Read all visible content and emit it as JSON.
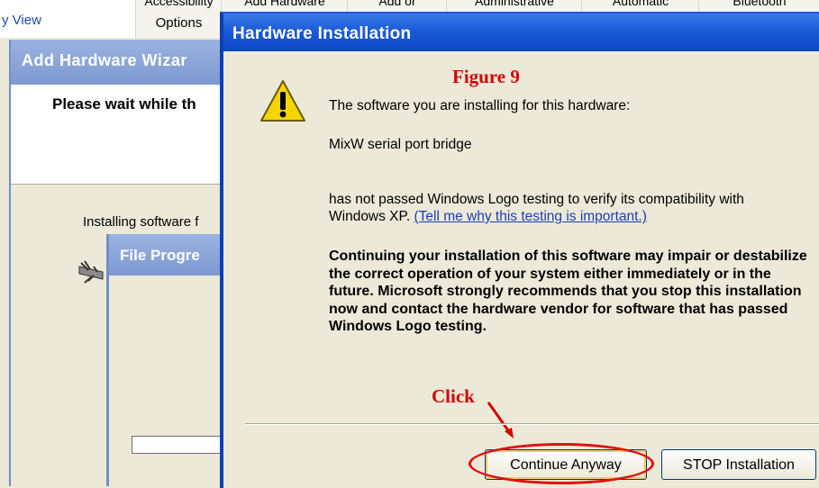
{
  "control_panel": {
    "category_view": "y View",
    "tabs": [
      {
        "cut": "Accessibility",
        "label": "Options"
      },
      {
        "cut": "Add Hardware",
        "label": ""
      },
      {
        "cut": "Add or",
        "label": ""
      },
      {
        "cut": "Administrative",
        "label": ""
      },
      {
        "cut": "Automatic",
        "label": ""
      },
      {
        "cut": "Bluetooth",
        "label": ""
      }
    ]
  },
  "add_hardware_wizard": {
    "title": "Add Hardware Wizar",
    "heading": "Please wait while th",
    "status": "Installing software f"
  },
  "file_progress": {
    "title": "File Progre"
  },
  "hardware_installation": {
    "title": "Hardware Installation",
    "figure_label": "Figure 9",
    "line1": "The software you are installing for this hardware:",
    "device": "MixW serial port bridge",
    "line3_a": "has not passed Windows Logo testing to verify its compatibility with Windows XP. ",
    "link": "(Tell me why this testing is important.)",
    "warning": "Continuing your installation of this software may impair or destabilize the correct operation of your system either immediately or in the future. Microsoft strongly recommends that you stop this installation now and contact the hardware vendor for software that has passed Windows Logo testing.",
    "click_label": "Click",
    "continue_button": "Continue Anyway",
    "stop_button": "STOP Installation"
  },
  "colors": {
    "annotation_red": "#d40000",
    "titlebar_blue": "#1c5bd6"
  }
}
